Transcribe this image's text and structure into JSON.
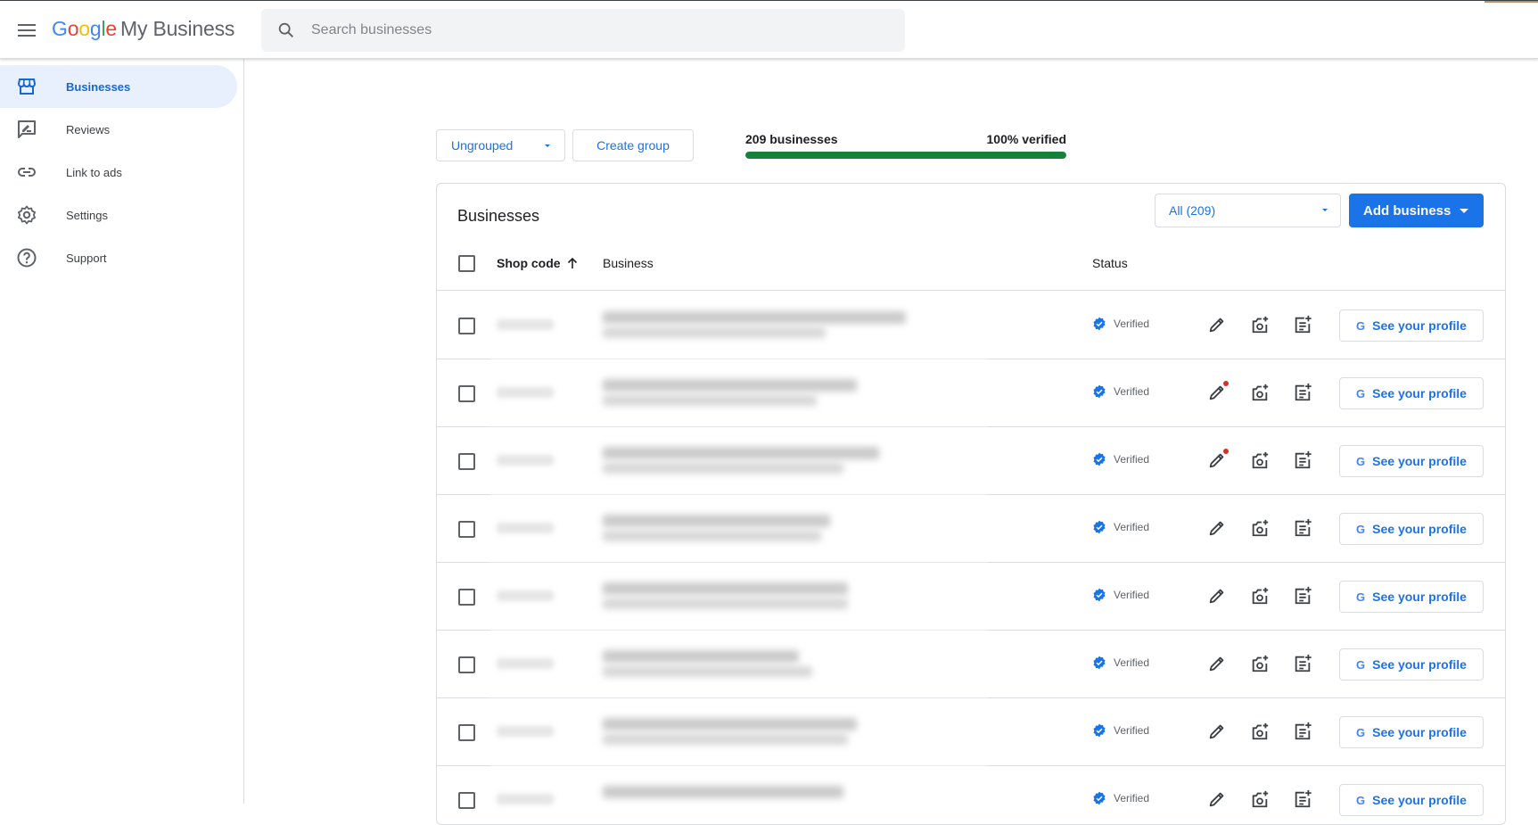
{
  "app": {
    "brand_google": [
      "G",
      "o",
      "o",
      "g",
      "l",
      "e"
    ],
    "brand_rest": "My Business"
  },
  "search": {
    "placeholder": "Search businesses"
  },
  "sidebar": {
    "items": [
      {
        "label": "Businesses",
        "icon": "store-icon",
        "active": true
      },
      {
        "label": "Reviews",
        "icon": "rate-review-icon",
        "active": false
      },
      {
        "label": "Link to ads",
        "icon": "link-icon",
        "active": false
      },
      {
        "label": "Settings",
        "icon": "gear-icon",
        "active": false
      },
      {
        "label": "Support",
        "icon": "help-icon",
        "active": false
      }
    ]
  },
  "toolbar": {
    "group_dropdown": "Ungrouped",
    "create_group": "Create group"
  },
  "summary": {
    "count_label": "209 businesses",
    "verified_label": "100% verified",
    "verified_fraction": 1.0,
    "bar_color": "#188038"
  },
  "table": {
    "title": "Businesses",
    "filter": "All (209)",
    "add_button": "Add business",
    "columns": {
      "shop_code": "Shop code",
      "business": "Business",
      "status": "Status"
    },
    "status_label": "Verified",
    "profile_button": "See your profile",
    "rows": [
      {
        "status": "Verified",
        "edit_alert": false
      },
      {
        "status": "Verified",
        "edit_alert": true
      },
      {
        "status": "Verified",
        "edit_alert": true
      },
      {
        "status": "Verified",
        "edit_alert": false
      },
      {
        "status": "Verified",
        "edit_alert": false
      },
      {
        "status": "Verified",
        "edit_alert": false
      },
      {
        "status": "Verified",
        "edit_alert": false
      },
      {
        "status": "Verified",
        "edit_alert": false
      }
    ]
  },
  "colors": {
    "accent": "#1a73e8",
    "verified": "#1a73e8",
    "alert": "#d93025"
  }
}
